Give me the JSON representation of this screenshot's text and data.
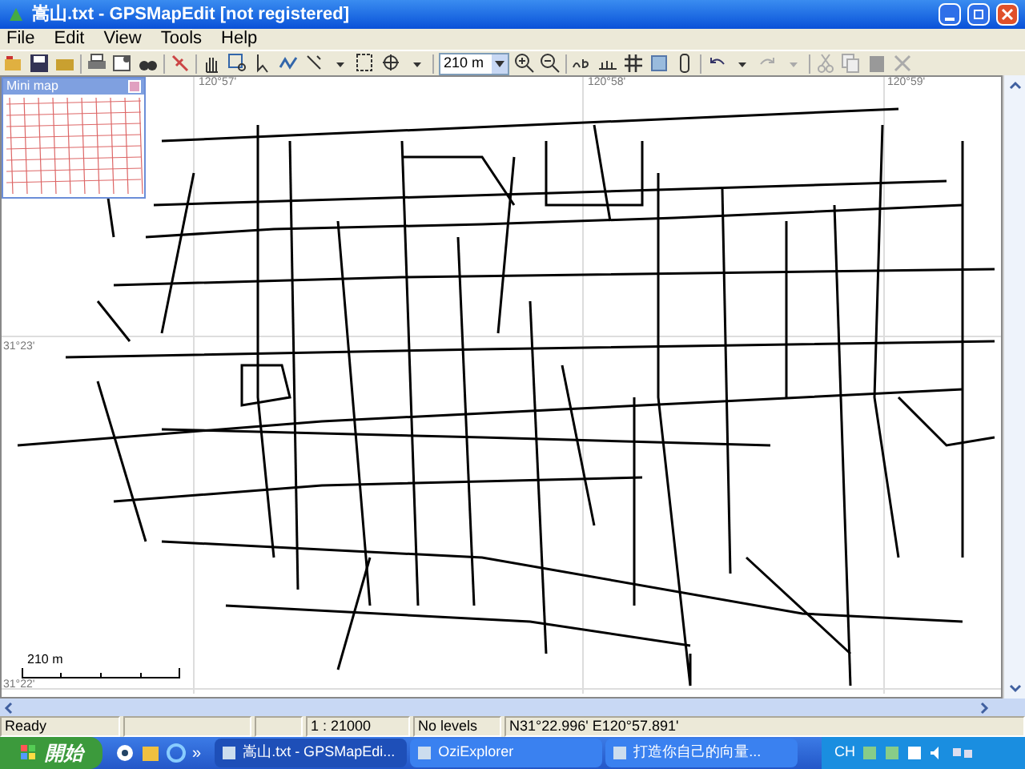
{
  "window": {
    "title": "嵩山.txt - GPSMapEdit [not registered]"
  },
  "menu": [
    "File",
    "Edit",
    "View",
    "Tools",
    "Help"
  ],
  "toolbar": {
    "zoom_value": "210 m"
  },
  "mini_map": {
    "title": "Mini map"
  },
  "map": {
    "top_ruler": [
      "120°57'",
      "120°58'",
      "120°59'"
    ],
    "left_ruler": [
      "31°23'",
      "31°22'"
    ],
    "scale_label": "210 m"
  },
  "status_bar": [
    "Ready",
    "1 : 21000",
    "No levels",
    "N31°22.996' E120°57.891'"
  ],
  "taskbar": {
    "start": "開始",
    "overflow": "»",
    "tasks": [
      {
        "label": "嵩山.txt - GPSMapEdi...",
        "selected": true
      },
      {
        "label": "OziExplorer",
        "selected": false
      },
      {
        "label": "打造你自己的向量...",
        "selected": false
      }
    ],
    "language": "CH"
  }
}
